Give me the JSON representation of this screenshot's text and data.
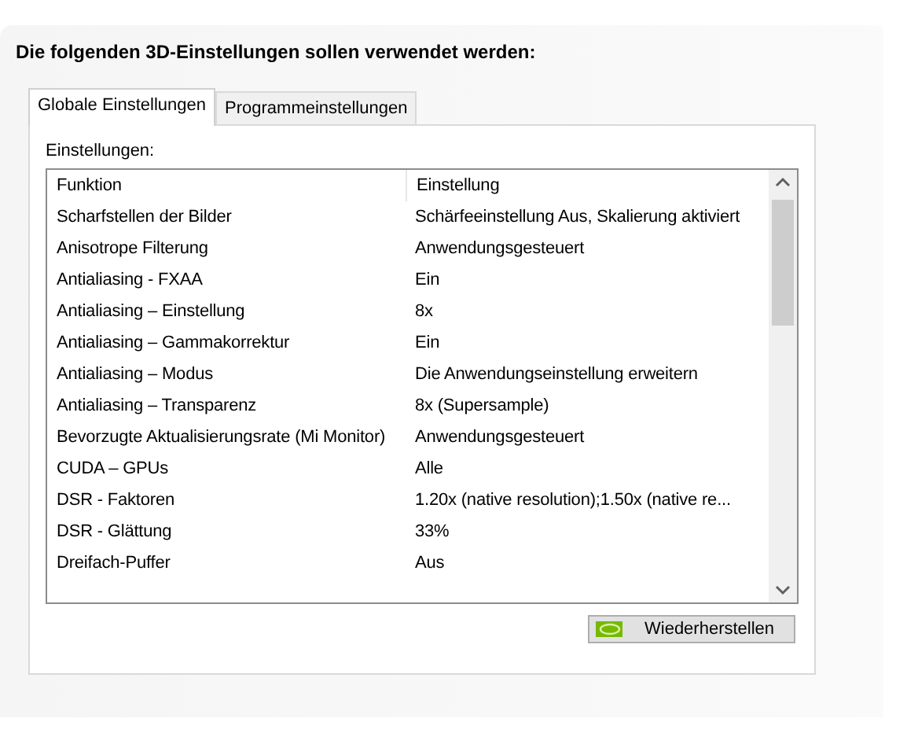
{
  "heading": "Die folgenden 3D-Einstellungen sollen verwendet werden:",
  "tabs": [
    {
      "label": "Globale Einstellungen",
      "selected": true
    },
    {
      "label": "Programmeinstellungen",
      "selected": false
    }
  ],
  "list_label": "Einstellungen:",
  "table": {
    "columns": [
      "Funktion",
      "Einstellung"
    ],
    "rows": [
      [
        "Scharfstellen der Bilder",
        "Schärfeeinstellung Aus, Skalierung aktiviert"
      ],
      [
        "Anisotrope Filterung",
        "Anwendungsgesteuert"
      ],
      [
        "Antialiasing - FXAA",
        "Ein"
      ],
      [
        "Antialiasing – Einstellung",
        "8x"
      ],
      [
        "Antialiasing – Gammakorrektur",
        "Ein"
      ],
      [
        "Antialiasing – Modus",
        "Die Anwendungseinstellung erweitern"
      ],
      [
        "Antialiasing – Transparenz",
        "8x (Supersample)"
      ],
      [
        "Bevorzugte Aktualisierungsrate (Mi Monitor)",
        "Anwendungsgesteuert"
      ],
      [
        "CUDA – GPUs",
        "Alle"
      ],
      [
        "DSR - Faktoren",
        "1.20x (native resolution);1.50x (native re..."
      ],
      [
        "DSR - Glättung",
        "33%"
      ],
      [
        "Dreifach-Puffer",
        "Aus"
      ]
    ]
  },
  "restore_button": "Wiederherstellen"
}
